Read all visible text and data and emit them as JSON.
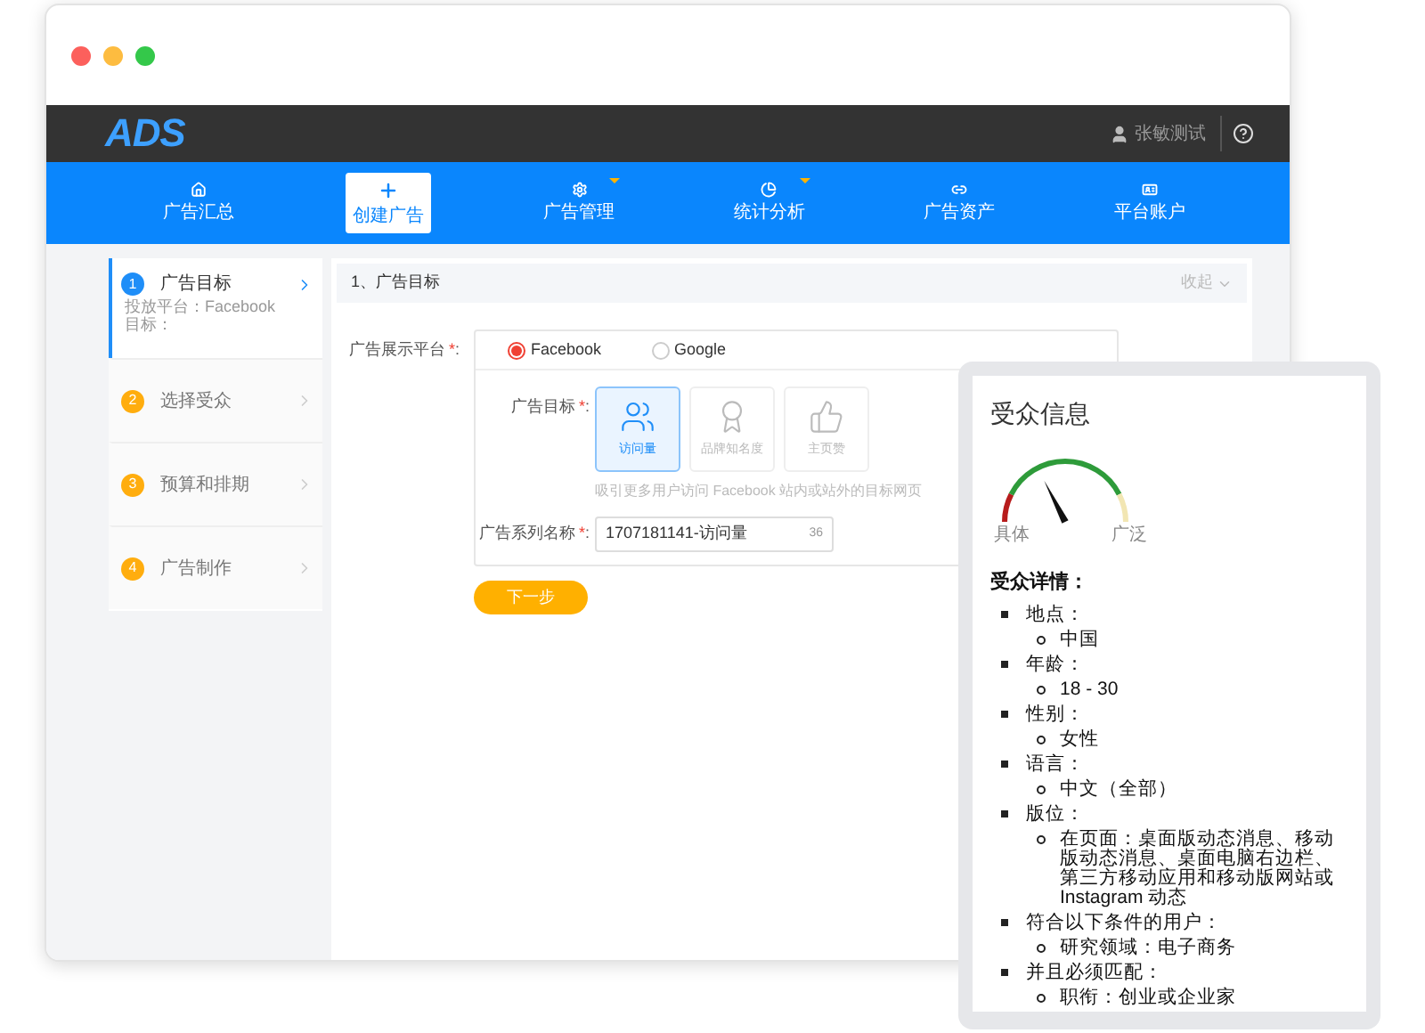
{
  "header": {
    "logo": "ADS",
    "user": "张敏测试"
  },
  "nav": [
    {
      "label": "广告汇总",
      "selected": false,
      "dropdown": false
    },
    {
      "label": "创建广告",
      "selected": true,
      "dropdown": false
    },
    {
      "label": "广告管理",
      "selected": false,
      "dropdown": true
    },
    {
      "label": "统计分析",
      "selected": false,
      "dropdown": true
    },
    {
      "label": "广告资产",
      "selected": false,
      "dropdown": false
    },
    {
      "label": "平台账户",
      "selected": false,
      "dropdown": false
    }
  ],
  "steps": [
    {
      "number": "1",
      "title": "广告目标",
      "selected": true,
      "details": [
        "投放平台：Facebook",
        "目标："
      ]
    },
    {
      "number": "2",
      "title": "选择受众",
      "selected": false
    },
    {
      "number": "3",
      "title": "预算和排期",
      "selected": false
    },
    {
      "number": "4",
      "title": "广告制作",
      "selected": false
    }
  ],
  "section": {
    "title": "1、广告目标",
    "collapse": "收起"
  },
  "form": {
    "platform_label": "广告展示平台",
    "required_mark": "*",
    "colon": ":",
    "platforms": [
      {
        "label": "Facebook",
        "selected": true
      },
      {
        "label": "Google",
        "selected": false
      }
    ],
    "objective_label": "广告目标",
    "objectives": [
      {
        "label": "访问量",
        "selected": true
      },
      {
        "label": "品牌知名度",
        "selected": false
      },
      {
        "label": "主页赞",
        "selected": false
      }
    ],
    "objective_hint": "吸引更多用户访问 Facebook 站内或站外的目标网页",
    "name_label": "广告系列名称",
    "name_value": "1707181141-访问量",
    "name_counter": "36",
    "next_button": "下一步"
  },
  "audience": {
    "title": "受众信息",
    "gauge": {
      "level": 0.35,
      "low_label": "具体",
      "high_label": "广泛"
    },
    "details_title": "受众详情：",
    "items": [
      {
        "label": "地点：",
        "children": [
          "中国"
        ]
      },
      {
        "label": "年龄：",
        "children": [
          "18 - 30"
        ]
      },
      {
        "label": "性别：",
        "children": [
          "女性"
        ]
      },
      {
        "label": "语言：",
        "children": [
          "中文（全部）"
        ]
      },
      {
        "label": "版位：",
        "children": [
          "在页面：桌面版动态消息、移动版动态消息、桌面电脑右边栏、第三方移动应用和移动版网站或 Instagram 动态"
        ]
      },
      {
        "label": "符合以下条件的用户：",
        "children": [
          "研究领域：电子商务"
        ]
      },
      {
        "label": "并且必须匹配：",
        "children": [
          "职衔：创业或企业家"
        ]
      }
    ]
  }
}
